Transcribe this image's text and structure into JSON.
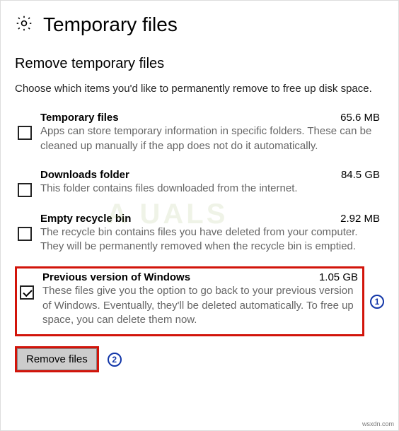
{
  "header": {
    "title": "Temporary files"
  },
  "section": {
    "subtitle": "Remove temporary files",
    "intro": "Choose which items you'd like to permanently remove to free up disk space."
  },
  "items": [
    {
      "title": "Temporary files",
      "size": "65.6 MB",
      "desc": "Apps can store temporary information in specific folders. These can be cleaned up manually if the app does not do it automatically.",
      "checked": false,
      "highlighted": false
    },
    {
      "title": "Downloads folder",
      "size": "84.5 GB",
      "desc": "This folder contains files downloaded from the internet.",
      "checked": false,
      "highlighted": false
    },
    {
      "title": "Empty recycle bin",
      "size": "2.92 MB",
      "desc": "The recycle bin contains files you have deleted from your computer. They will be permanently removed when the recycle bin is emptied.",
      "checked": false,
      "highlighted": false
    },
    {
      "title": "Previous version of Windows",
      "size": "1.05 GB",
      "desc": "These files give you the option to go back to your previous version of Windows. Eventually, they'll be deleted automatically. To free up space, you can delete them now.",
      "checked": true,
      "highlighted": true
    }
  ],
  "actions": {
    "remove_label": "Remove files"
  },
  "annotations": {
    "one": "1",
    "two": "2"
  },
  "watermark": "wsxdn.com",
  "bg_mark": "A   UALS"
}
